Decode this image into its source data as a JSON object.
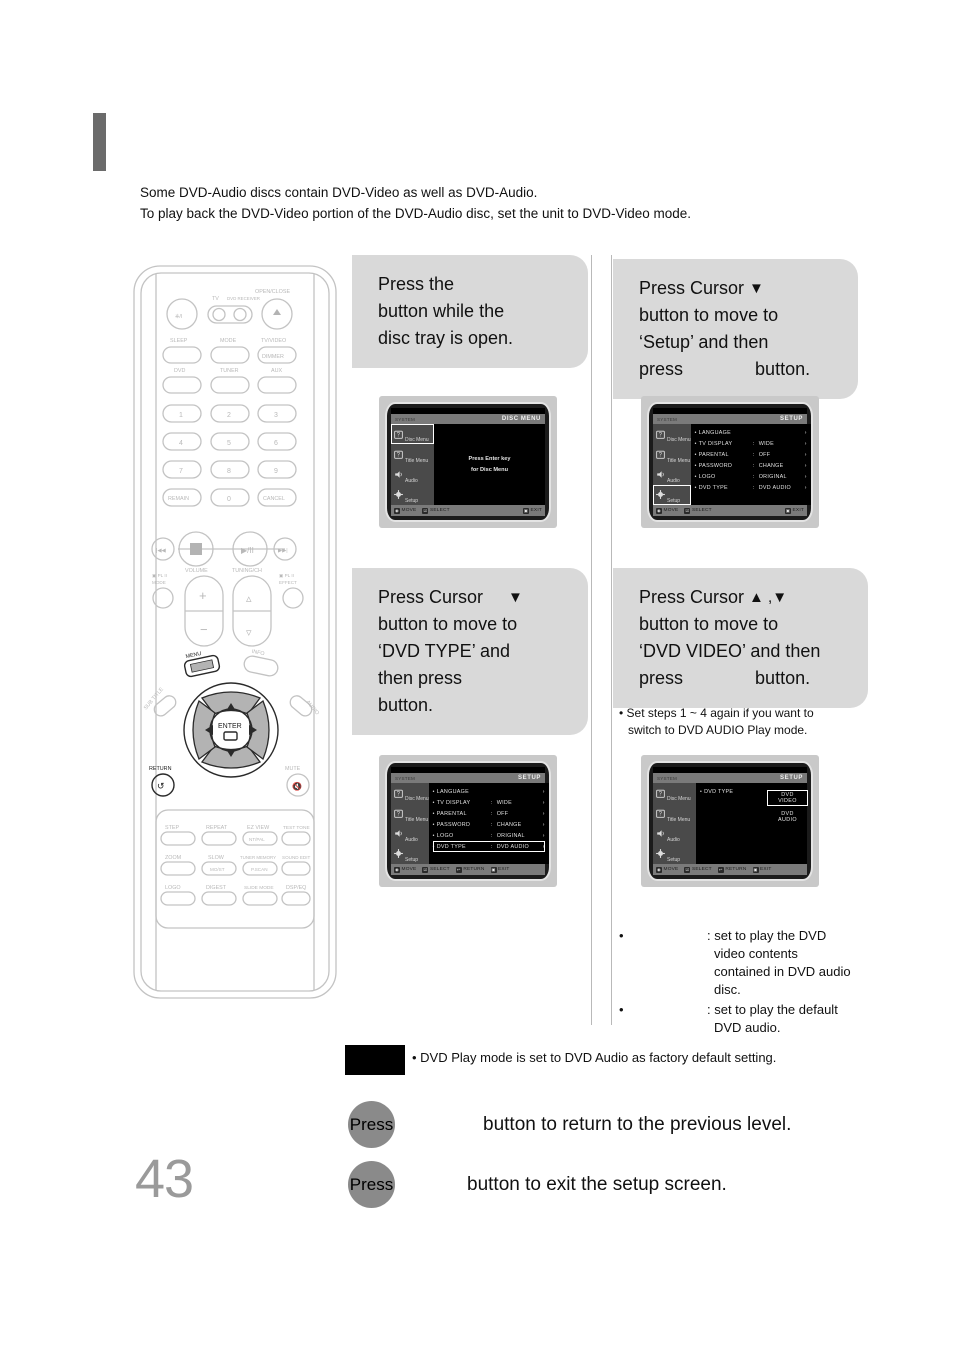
{
  "page": {
    "number": "43",
    "intro_line1": "Some DVD-Audio discs contain DVD-Video as well as DVD-Audio.",
    "intro_line2": "To play back the DVD-Video portion of the DVD-Audio disc, set the unit to DVD-Video mode."
  },
  "steps": [
    {
      "id": "step-1",
      "bubble_lines": [
        "Press the",
        "button while the",
        "disc tray is open."
      ],
      "cursor_glyphs": ""
    },
    {
      "id": "step-2",
      "bubble_lines": [
        "Press Cursor ▼",
        "button to move to",
        "‘Setup’ and then",
        "press          button."
      ],
      "cursor_glyphs": "▼"
    },
    {
      "id": "step-3",
      "bubble_lines": [
        "Press Cursor  ▼",
        "button to move to",
        "‘DVD TYPE’ and",
        "then press",
        "button."
      ],
      "cursor_glyphs": "▼"
    },
    {
      "id": "step-4",
      "bubble_lines": [
        "Press Cursor ▲ ,▼",
        "button to move to",
        "‘DVD VIDEO’ and then",
        "press          button."
      ],
      "cursor_glyphs": "▲ ,▼"
    }
  ],
  "bubble_text": {
    "press_the": "Press the",
    "button_while": "button while the",
    "disc_tray_open": "disc tray is open.",
    "press_cursor": "Press Cursor",
    "button_to_move_to": "button to move to",
    "setup_and_then": "‘Setup’ and then",
    "press_word": "press",
    "button_word": "button.",
    "dvd_type_and": "‘DVD TYPE’ and",
    "then_press": "then press",
    "dvd_video_and_then": "‘DVD VIDEO’ and then",
    "tri_down": "▼",
    "tri_up_down": "▲ ,▼"
  },
  "osd": {
    "system_label": "SYSTEM",
    "sidebar": [
      {
        "label": "Disc Menu",
        "icon": "disc-menu-icon"
      },
      {
        "label": "Title Menu",
        "icon": "title-menu-icon"
      },
      {
        "label": "Audio",
        "icon": "speaker-icon"
      },
      {
        "label": "Setup",
        "icon": "gear-icon"
      }
    ],
    "footer_basic": [
      {
        "key": "◉",
        "label": "MOVE"
      },
      {
        "key": "☑",
        "label": "SELECT"
      },
      {
        "key": "▣",
        "label": "EXIT"
      }
    ],
    "footer_full": [
      {
        "key": "◉",
        "label": "MOVE"
      },
      {
        "key": "☑",
        "label": "SELECT"
      },
      {
        "key": "↩",
        "label": "RETURN"
      },
      {
        "key": "▣",
        "label": "EXIT"
      }
    ],
    "screen1": {
      "title": "DISC MENU",
      "center_line1": "Press Enter key",
      "center_line2": "for Disc Menu",
      "selected_side": 0
    },
    "screen2": {
      "title": "SETUP",
      "selected_side": 3,
      "rows": [
        {
          "label": "LANGUAGE",
          "value": "",
          "has_colon": false
        },
        {
          "label": "TV DISPLAY",
          "value": "WIDE",
          "has_colon": true
        },
        {
          "label": "PARENTAL",
          "value": "OFF",
          "has_colon": true
        },
        {
          "label": "PASSWORD",
          "value": "CHANGE",
          "has_colon": true
        },
        {
          "label": "LOGO",
          "value": "ORIGINAL",
          "has_colon": true
        },
        {
          "label": "DVD TYPE",
          "value": "DVD AUDIO",
          "has_colon": true
        }
      ]
    },
    "screen3": {
      "title": "SETUP",
      "selected_side": 3,
      "highlight_row": 5,
      "rows": [
        {
          "label": "LANGUAGE",
          "value": "",
          "has_colon": false
        },
        {
          "label": "TV DISPLAY",
          "value": "WIDE",
          "has_colon": true
        },
        {
          "label": "PARENTAL",
          "value": "OFF",
          "has_colon": true
        },
        {
          "label": "PASSWORD",
          "value": "CHANGE",
          "has_colon": true
        },
        {
          "label": "LOGO",
          "value": "ORIGINAL",
          "has_colon": true
        },
        {
          "label": "DVD TYPE",
          "value": "DVD AUDIO",
          "has_colon": true
        }
      ]
    },
    "screen4": {
      "title": "SETUP",
      "selected_side": 3,
      "row_label": "DVD TYPE",
      "options": [
        {
          "label": "DVD VIDEO",
          "selected": true
        },
        {
          "label": "DVD AUDIO",
          "selected": false
        }
      ]
    }
  },
  "notes": {
    "set_steps_line1": "• Set steps 1 ~ 4 again if you want to",
    "set_steps_line2": "switch to DVD AUDIO Play mode.",
    "bullet1": {
      "bullet": "•",
      "term": "",
      "lines": [
        ": set to play the DVD",
        "video contents",
        "contained in DVD audio",
        "disc."
      ]
    },
    "bullet2": {
      "bullet": "•",
      "term": "",
      "lines": [
        ": set to play the default",
        "DVD audio."
      ]
    },
    "note_label": "",
    "note_text": "• DVD Play mode is set to DVD Audio as factory default setting."
  },
  "press_rows": [
    {
      "pill": "Press",
      "text": "button to return to the previous level."
    },
    {
      "pill": "Press",
      "text": "button to exit the setup screen."
    }
  ],
  "remote": {
    "labels": {
      "open_close": "OPEN/CLOSE",
      "tv": "TV",
      "dvd_receiver": "DVD RECEIVER",
      "sleep": "SLEEP",
      "mode": "MODE",
      "tv_video": "TV/VIDEO",
      "dimmer": "DIMMER",
      "dvd": "DVD",
      "tuner": "TUNER",
      "aux": "AUX",
      "n1": "1",
      "n2": "2",
      "n3": "3",
      "n4": "4",
      "n5": "5",
      "n6": "6",
      "n7": "7",
      "n8": "8",
      "n9": "9",
      "remain": "REMAIN",
      "n0": "0",
      "cancel": "CANCEL",
      "volume": "VOLUME",
      "tuning_ch": "TUNING/CH",
      "pl2_mode_1": "PL II",
      "pl2_mode_2": "MODE",
      "pl2_effect_1": "PL II",
      "pl2_effect_2": "EFFECT",
      "menu": "MENU",
      "info": "INFO",
      "sub_title": "SUB TITLE",
      "audio": "AUDIO",
      "enter": "ENTER",
      "return": "RETURN",
      "mute": "MUTE",
      "step": "STEP",
      "repeat": "REPEAT",
      "ez_view": "EZ VIEW",
      "nt_pal": "NT/PAL",
      "test_tone": "TEST TONE",
      "zoom": "ZOOM",
      "slow": "SLOW",
      "mo_st": "MO/ST",
      "tuner_memory": "TUNER MEMORY",
      "p_scan": "P.SCAN",
      "sound_edit": "SOUND EDIT",
      "logo": "LOGO",
      "digest": "DIGEST",
      "slide_mode": "SLIDE MODE",
      "dsp_eq": "DSP/EQ"
    }
  },
  "colors": {
    "bubble_bg": "#d9d9d9",
    "pill_bg": "#8a8a8a",
    "page_num": "#9a9a9a",
    "header_bar": "#6b6b6b",
    "osd_bar": "#7a7a7a",
    "osd_side": "#4a4a4a"
  }
}
